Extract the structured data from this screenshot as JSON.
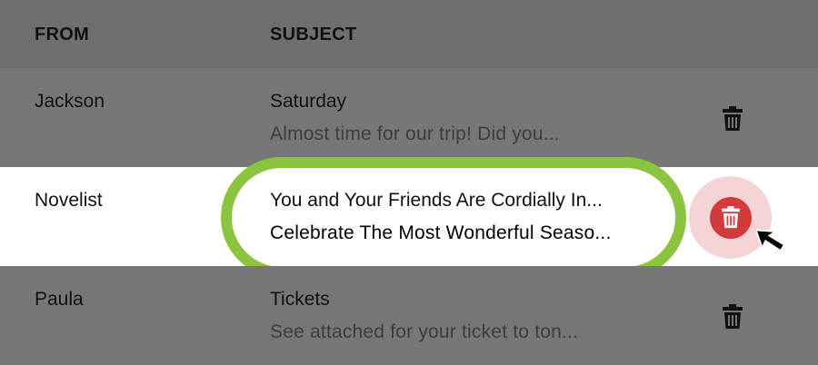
{
  "table": {
    "headers": {
      "from": "FROM",
      "subject": "SUBJECT"
    },
    "rows": [
      {
        "from": "Jackson",
        "subject": "Saturday",
        "preview": "Almost time for our trip! Did you...",
        "state": "dimmed"
      },
      {
        "from": "Novelist",
        "subject": "You and Your Friends Are Cordially In...",
        "preview": "Celebrate The Most Wonderful Seaso...",
        "state": "highlighted"
      },
      {
        "from": "Paula",
        "subject": "Tickets",
        "preview": "See attached for your ticket to ton...",
        "state": "dimmed"
      }
    ]
  },
  "icons": {
    "row_action": "trash-icon",
    "pointer": "mouse-pointer-icon"
  },
  "colors": {
    "overlay": "#777777",
    "highlight_ring": "#8bc53f",
    "delete_red": "#d33b3b",
    "delete_halo": "#f4d4d4"
  }
}
